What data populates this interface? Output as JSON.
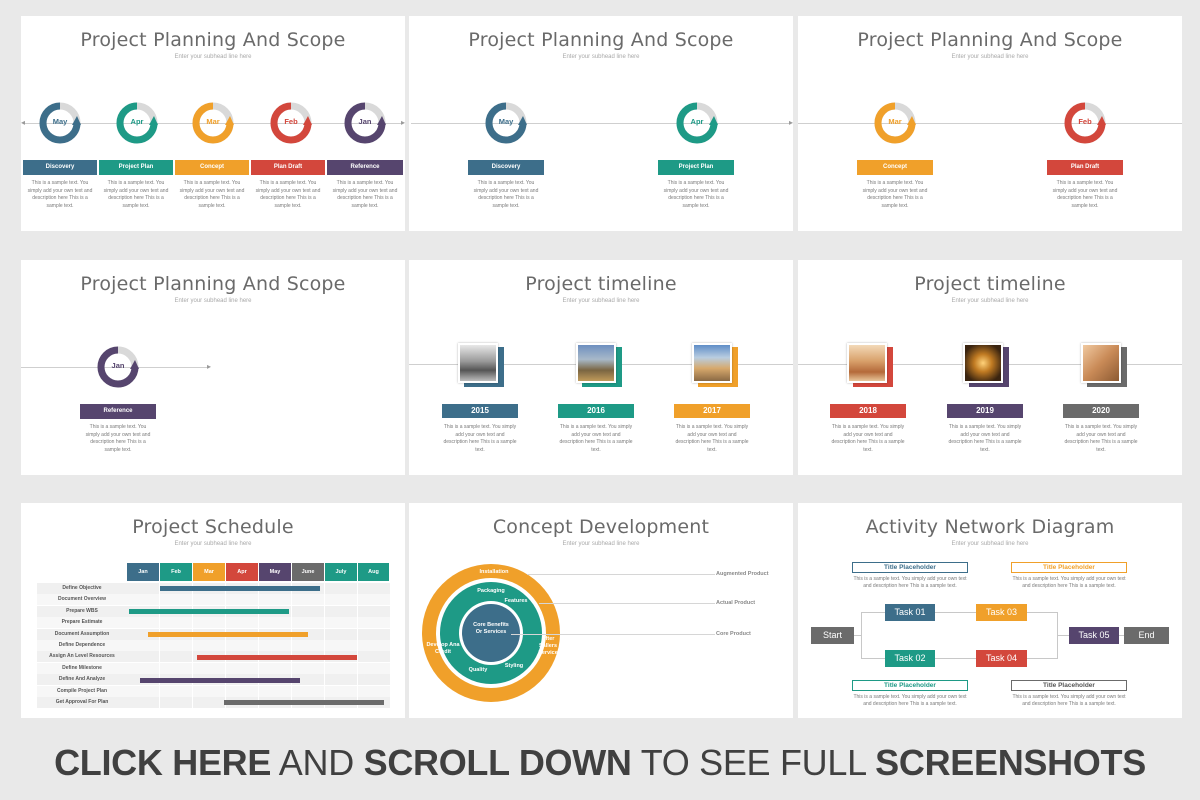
{
  "colors": {
    "teal_blue": "#3d6e8a",
    "green": "#1e9a86",
    "orange": "#f0a02a",
    "red": "#d3473c",
    "purple": "#56456e",
    "grey": "#6b6b6b"
  },
  "common": {
    "subhead": "Enter your subhead line here",
    "sample_desc": "This is a sample text. You simply add your own text and description here This is a sample text."
  },
  "slides": {
    "planning_title": "Project Planning And Scope",
    "months": [
      "May",
      "Apr",
      "Mar",
      "Feb",
      "Jan"
    ],
    "phases": [
      "Discovery",
      "Project Plan",
      "Concept",
      "Plan Draft",
      "Reference"
    ],
    "timeline_title": "Project timeline",
    "years_a": [
      "2015",
      "2016",
      "2017"
    ],
    "years_b": [
      "2018",
      "2019",
      "2020"
    ],
    "schedule_title": "Project Schedule",
    "schedule_months": [
      "Jan",
      "Feb",
      "Mar",
      "Apr",
      "May",
      "June",
      "July",
      "Aug"
    ],
    "schedule_tasks": [
      "Define Objective",
      "Document Overview",
      "Prepare WBS",
      "Prepare Estimate",
      "Document Assumption",
      "Define Dependence",
      "Assign An Level Resources",
      "Define Milestone",
      "Define And Analyze",
      "Compile Project Plan",
      "Get Approval For Plan"
    ],
    "concept_title": "Concept Development",
    "concept_outer": [
      "Installation",
      "After Sallers Service",
      "Develop Ana Credit"
    ],
    "concept_middle": [
      "Packaging",
      "Features",
      "Styling",
      "Quality"
    ],
    "concept_core": "Core Benefits Or Services",
    "concept_labels": [
      "Augmented Product",
      "Actual Product",
      "Core Product"
    ],
    "network_title": "Activity Network Diagram",
    "network_title_placeholder": "Title Placeholder",
    "network_desc": "This is a sample text. You simply add your own text and description here This is a sample text.",
    "network_nodes": {
      "start": "Start",
      "t1": "Task 01",
      "t2": "Task 02",
      "t3": "Task 03",
      "t4": "Task 04",
      "t5": "Task 05",
      "end": "End"
    }
  },
  "banner": {
    "part1": "CLICK HERE",
    "part2": " AND ",
    "part3": "SCROLL DOWN",
    "part4": " TO SEE FULL ",
    "part5": "SCREENSHOTS"
  }
}
